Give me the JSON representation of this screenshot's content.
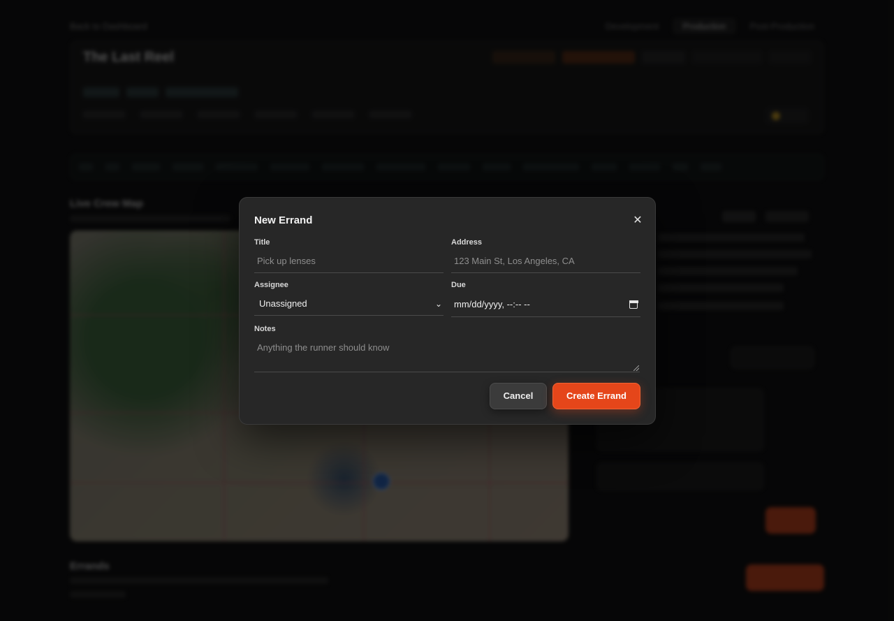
{
  "modal": {
    "title": "New Errand",
    "close_icon": "close-icon",
    "fields": {
      "title": {
        "label": "Title",
        "placeholder": "Pick up lenses"
      },
      "address": {
        "label": "Address",
        "placeholder": "123 Main St, Los Angeles, CA"
      },
      "assignee": {
        "label": "Assignee",
        "value": "Unassigned"
      },
      "due": {
        "label": "Due",
        "placeholder": "mm/dd/yyyy, --:-- --"
      },
      "notes": {
        "label": "Notes",
        "placeholder": "Anything the runner should know"
      }
    },
    "cancel_label": "Cancel",
    "create_label": "Create Errand"
  },
  "background": {
    "back_link": "Back to Dashboard",
    "env_tabs": [
      "Development",
      "Production",
      "Post-Production"
    ],
    "project_title": "The Last Reel",
    "map_title": "Live Crew Map",
    "errands_title": "Errands",
    "colors": {
      "accent": "#e5461a",
      "modal_bg": "#272727",
      "page_bg": "#0a0a0b"
    }
  }
}
